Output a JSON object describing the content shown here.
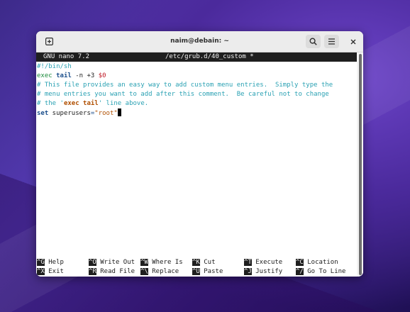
{
  "window": {
    "title": "naim@debain: ~"
  },
  "nano": {
    "version": "GNU nano 7.2",
    "filename": "/etc/grub.d/40_custom *"
  },
  "editor": {
    "shebang": "#!/bin/sh",
    "exec_kw": "exec",
    "exec_tail": "tail",
    "exec_opts": " -n +3 ",
    "exec_var": "$0",
    "comment1": "# This file provides an easy way to add custom menu entries.  Simply type the",
    "comment2": "# menu entries you want to add after this comment.  Be careful not to change",
    "comment3_pre": "# the '",
    "comment3_code": "exec tail",
    "comment3_post": "' line above.",
    "set_kw": "set",
    "set_var": " superusers",
    "set_eq": "=",
    "set_val": "\"root\""
  },
  "shortcuts": [
    {
      "key": "^G",
      "label": "Help"
    },
    {
      "key": "^O",
      "label": "Write Out"
    },
    {
      "key": "^W",
      "label": "Where Is"
    },
    {
      "key": "^K",
      "label": "Cut"
    },
    {
      "key": "^T",
      "label": "Execute"
    },
    {
      "key": "^C",
      "label": "Location"
    },
    {
      "key": "^X",
      "label": "Exit"
    },
    {
      "key": "^R",
      "label": "Read File"
    },
    {
      "key": "^\\",
      "label": "Replace"
    },
    {
      "key": "^U",
      "label": "Paste"
    },
    {
      "key": "^J",
      "label": "Justify"
    },
    {
      "key": "^/",
      "label": "Go To Line"
    }
  ],
  "colors": {
    "comment": "#2aa1b3",
    "keyword": "#1a8a3a",
    "bold_blue": "#1c4f8c",
    "variable": "#c01c28",
    "string": "#b04f00"
  }
}
